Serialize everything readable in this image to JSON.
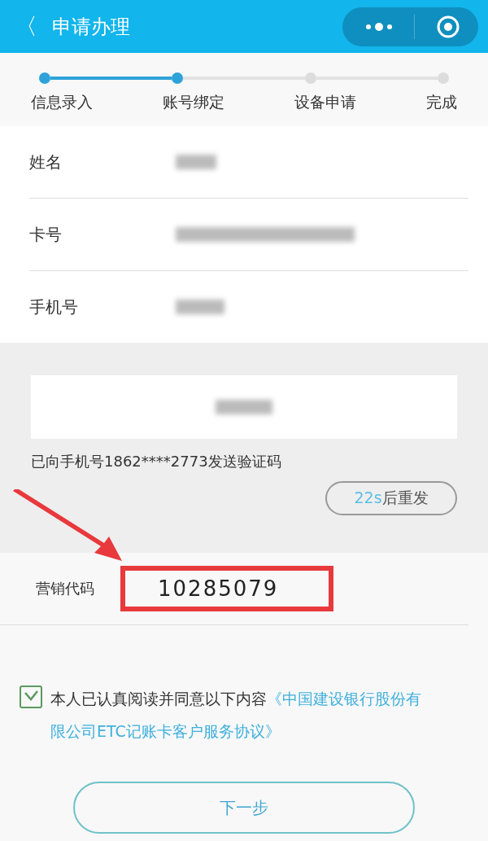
{
  "nav_bar": {
    "back_icon": "〈",
    "title": "申请办理"
  },
  "steps": [
    {
      "label": "信息录入",
      "done": true
    },
    {
      "label": "账号绑定",
      "done": true
    },
    {
      "label": "设备申请",
      "done": false
    },
    {
      "label": "完成",
      "done": false
    }
  ],
  "fields": [
    {
      "label": "姓名",
      "value_hidden": true
    },
    {
      "label": "卡号",
      "value_hidden": true
    },
    {
      "label": "手机号",
      "value_hidden": true
    }
  ],
  "verification": {
    "code_hidden": true,
    "notice": "已向手机号1862****2773发送验证码",
    "resend": {
      "countdown": "22s",
      "label": "后重发",
      "disabled": true
    }
  },
  "marketing_code": {
    "label": "营销代码",
    "value": "10285079",
    "highlighted": true
  },
  "agreement": {
    "checked": true,
    "text": "本人已认真阅读并同意以下内容",
    "link_lines": [
      "《中国建设银行股份有",
      "限公司ETC记账卡客户服务协议》"
    ]
  },
  "next_button": {
    "label": "下一步"
  }
}
